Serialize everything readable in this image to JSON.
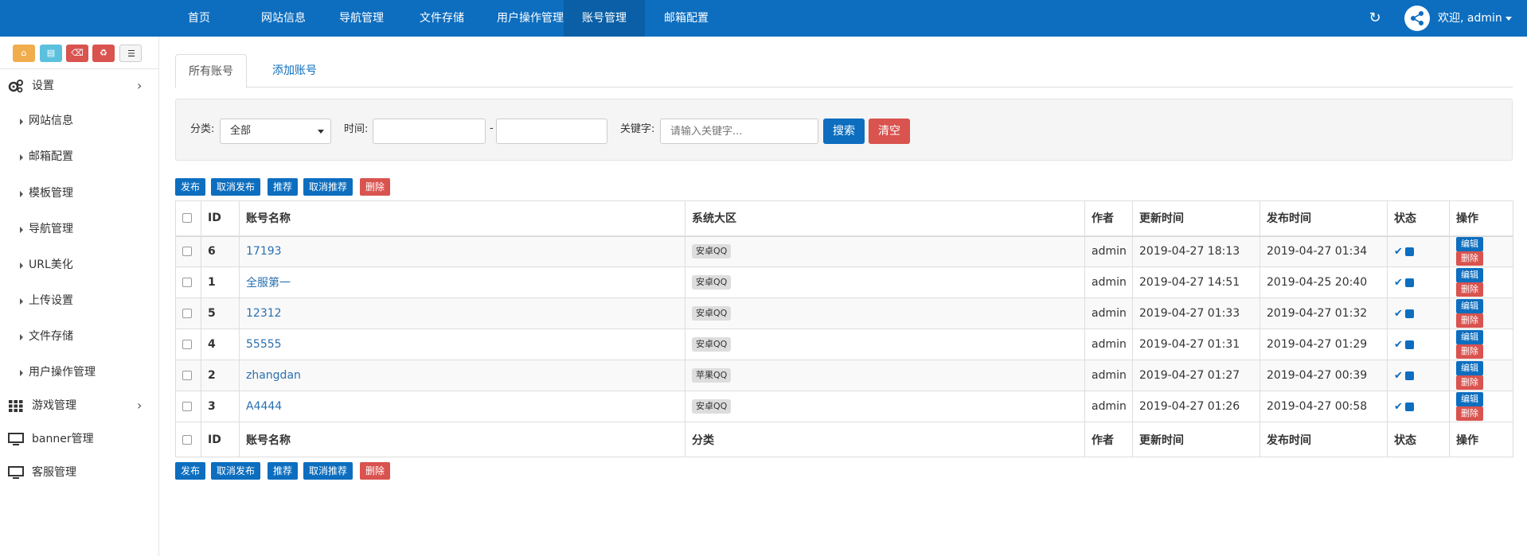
{
  "topnav": {
    "items": [
      "首页",
      "网站信息",
      "导航管理",
      "文件存储",
      "用户操作管理",
      "账号管理",
      "邮箱配置"
    ],
    "active": "账号管理",
    "welcome": "欢迎, admin"
  },
  "sidebar": {
    "quick_buttons": [
      {
        "icon": "home-icon",
        "glyph": "⌂",
        "color": "#f0ad4e"
      },
      {
        "icon": "file-icon",
        "glyph": "▤",
        "color": "#5bc0de"
      },
      {
        "icon": "trash-icon",
        "glyph": "🗑",
        "color": "#d9534f"
      },
      {
        "icon": "recycle-icon",
        "glyph": "♻",
        "color": "#d9534f"
      },
      {
        "icon": "list-icon",
        "glyph": "☰",
        "color": "#f5f5f5"
      }
    ],
    "settings_group": {
      "label": "设置",
      "icon": "gears-icon"
    },
    "settings_items": [
      "网站信息",
      "邮箱配置",
      "模板管理",
      "导航管理",
      "URL美化",
      "上传设置",
      "文件存储",
      "用户操作管理"
    ],
    "game_group": {
      "label": "游戏管理",
      "icon": "grid-icon"
    },
    "banner_group": {
      "label": "banner管理",
      "icon": "monitor-icon"
    },
    "service_group": {
      "label": "客服管理",
      "icon": "monitor-icon"
    }
  },
  "tabs": {
    "all": "所有账号",
    "add": "添加账号"
  },
  "filter": {
    "category_label": "分类:",
    "category_value": "全部",
    "time_label": "时间:",
    "dash": "-",
    "keyword_label": "关键字:",
    "keyword_placeholder": "请输入关键字...",
    "search": "搜索",
    "clear": "清空"
  },
  "actions": {
    "publish": "发布",
    "unpublish": "取消发布",
    "recommend": "推荐",
    "unrecommend": "取消推荐",
    "delete": "删除"
  },
  "table": {
    "headers": {
      "id": "ID",
      "name": "账号名称",
      "region": "系统大区",
      "author": "作者",
      "updated": "更新时间",
      "published": "发布时间",
      "status": "状态",
      "ops": "操作"
    },
    "footer_headers": {
      "id": "ID",
      "name": "账号名称",
      "region": "分类",
      "author": "作者",
      "updated": "更新时间",
      "published": "发布时间",
      "status": "状态",
      "ops": "操作"
    },
    "rows": [
      {
        "id": "6",
        "name": "17193",
        "region": "安卓QQ",
        "author": "admin",
        "updated": "2019-04-27 18:13",
        "published": "2019-04-27 01:34"
      },
      {
        "id": "1",
        "name": "全服第一",
        "region": "安卓QQ",
        "author": "admin",
        "updated": "2019-04-27 14:51",
        "published": "2019-04-25 20:40"
      },
      {
        "id": "5",
        "name": "12312",
        "region": "安卓QQ",
        "author": "admin",
        "updated": "2019-04-27 01:33",
        "published": "2019-04-27 01:32"
      },
      {
        "id": "4",
        "name": "55555",
        "region": "安卓QQ",
        "author": "admin",
        "updated": "2019-04-27 01:31",
        "published": "2019-04-27 01:29"
      },
      {
        "id": "2",
        "name": "zhangdan",
        "region": "苹果QQ",
        "author": "admin",
        "updated": "2019-04-27 01:27",
        "published": "2019-04-27 00:39"
      },
      {
        "id": "3",
        "name": "A4444",
        "region": "安卓QQ",
        "author": "admin",
        "updated": "2019-04-27 01:26",
        "published": "2019-04-27 00:58"
      }
    ],
    "row_ops": {
      "edit": "编辑",
      "delete": "删除"
    },
    "status_check": "✔"
  },
  "colors": {
    "primary": "#0d6ebf",
    "danger": "#d9534f"
  }
}
